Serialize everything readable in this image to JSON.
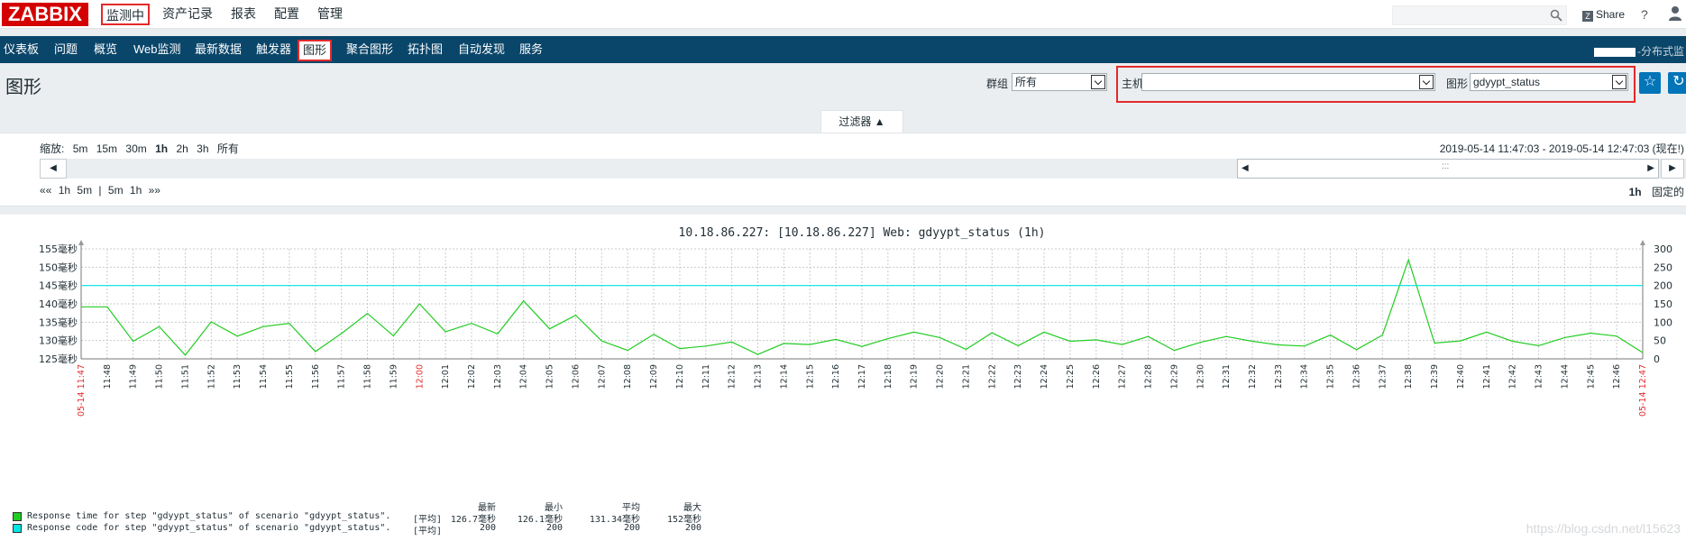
{
  "brand": {
    "logo_text": "ZABBIX",
    "accent": "#d40000",
    "nav_bg": "#0a466a",
    "highlight": "#e4292b"
  },
  "top_menu": [
    {
      "label": "监测中",
      "active": true
    },
    {
      "label": "资产记录",
      "active": false
    },
    {
      "label": "报表",
      "active": false
    },
    {
      "label": "配置",
      "active": false
    },
    {
      "label": "管理",
      "active": false
    }
  ],
  "top_right": {
    "search_value": "",
    "share_label": "Share",
    "help_glyph": "?"
  },
  "sub_menu": [
    {
      "label": "仪表板",
      "active": false
    },
    {
      "label": "问题",
      "active": false
    },
    {
      "label": "概览",
      "active": false
    },
    {
      "label": "Web监测",
      "active": false
    },
    {
      "label": "最新数据",
      "active": false
    },
    {
      "label": "触发器",
      "active": false
    },
    {
      "label": "图形",
      "active": true
    },
    {
      "label": "聚合图形",
      "active": false
    },
    {
      "label": "拓扑图",
      "active": false
    },
    {
      "label": "自动发现",
      "active": false
    },
    {
      "label": "服务",
      "active": false
    }
  ],
  "sub_menu_right": "-分布式监",
  "header": {
    "title": "图形",
    "group_label": "群组",
    "group_value": "所有",
    "host_label": "主机",
    "host_value": "",
    "graph_label": "图形",
    "graph_value": "gdyypt_status",
    "fav_glyph": "☆",
    "refresh_glyph": "↻"
  },
  "filter": {
    "tab_label": "过滤器 ▲",
    "zoom_label": "缩放:",
    "zoom_options": [
      "5m",
      "15m",
      "30m",
      "1h",
      "2h",
      "3h",
      "所有"
    ],
    "zoom_active": "1h",
    "time_range": "2019-05-14 11:47:03 - 2019-05-14 12:47:03 (现在!)",
    "step_left": [
      "««",
      "1h",
      "5m",
      "|",
      "5m",
      "1h",
      "»»"
    ],
    "period_label": "1h",
    "fixed_label": "固定的"
  },
  "chart_data": {
    "type": "line",
    "title": "10.18.86.227: [10.18.86.227] Web: gdyypt_status (1h)",
    "x_labels": [
      "11:48",
      "11:49",
      "11:50",
      "11:51",
      "11:52",
      "11:53",
      "11:54",
      "11:55",
      "11:56",
      "11:57",
      "11:58",
      "11:59",
      "12:00",
      "12:01",
      "12:02",
      "12:03",
      "12:04",
      "12:05",
      "12:06",
      "12:07",
      "12:08",
      "12:09",
      "12:10",
      "12:11",
      "12:12",
      "12:13",
      "12:14",
      "12:15",
      "12:16",
      "12:17",
      "12:18",
      "12:19",
      "12:20",
      "12:21",
      "12:22",
      "12:23",
      "12:24",
      "12:25",
      "12:26",
      "12:27",
      "12:28",
      "12:29",
      "12:30",
      "12:31",
      "12:32",
      "12:33",
      "12:34",
      "12:35",
      "12:36",
      "12:37",
      "12:38",
      "12:39",
      "12:40",
      "12:41",
      "12:42",
      "12:43",
      "12:44",
      "12:45",
      "12:46"
    ],
    "x_start_label": "05-14 11:47",
    "x_end_label": "05-14 12:47",
    "y_left_ticks": [
      "155毫秒",
      "150毫秒",
      "145毫秒",
      "140毫秒",
      "135毫秒",
      "130毫秒",
      "125毫秒"
    ],
    "y_left_range": [
      125,
      155
    ],
    "y_right_ticks": [
      "300",
      "250",
      "200",
      "150",
      "100",
      "50",
      "0"
    ],
    "y_right_range": [
      0,
      300
    ],
    "series": [
      {
        "name": "Response time for step \"gdyypt_status\" of scenario \"gdyypt_status\".",
        "color": "#22cc22",
        "axis": "left",
        "values": [
          139.2,
          139.2,
          129.8,
          133.8,
          126.0,
          135.1,
          131.2,
          133.8,
          134.7,
          127.0,
          131.9,
          137.4,
          131.3,
          140.0,
          132.4,
          134.7,
          131.8,
          140.8,
          133.2,
          136.9,
          129.9,
          127.3,
          131.7,
          127.8,
          128.5,
          129.6,
          126.2,
          129.2,
          128.9,
          130.3,
          128.4,
          130.5,
          132.3,
          130.8,
          127.6,
          132.1,
          128.6,
          132.3,
          129.8,
          130.2,
          128.9,
          131.1,
          127.3,
          129.5,
          131.1,
          129.8,
          128.8,
          128.5,
          131.5,
          127.5,
          131.5,
          152.0,
          129.3,
          129.9,
          132.3,
          129.8,
          128.6,
          130.8,
          132.0,
          131.2,
          126.7
        ],
        "legend_fn": "[平均]",
        "last": "126.7毫秒",
        "min": "126.1毫秒",
        "avg": "131.34毫秒",
        "max": "152毫秒"
      },
      {
        "name": "Response code for step \"gdyypt_status\" of scenario \"gdyypt_status\".",
        "color": "#00e5e5",
        "axis": "right",
        "values": [
          200,
          200,
          200,
          200,
          200,
          200,
          200,
          200,
          200,
          200,
          200,
          200,
          200,
          200,
          200,
          200,
          200,
          200,
          200,
          200,
          200,
          200,
          200,
          200,
          200,
          200,
          200,
          200,
          200,
          200,
          200,
          200,
          200,
          200,
          200,
          200,
          200,
          200,
          200,
          200,
          200,
          200,
          200,
          200,
          200,
          200,
          200,
          200,
          200,
          200,
          200,
          200,
          200,
          200,
          200,
          200,
          200,
          200,
          200,
          200,
          200
        ],
        "legend_fn": "[平均]",
        "last": "200",
        "min": "200",
        "avg": "200",
        "max": "200"
      }
    ],
    "legend_headers": [
      "最新",
      "最小",
      "平均",
      "最大"
    ],
    "grid": true,
    "legend_position": "bottom-left"
  },
  "watermark": "https://blog.csdn.net/l15623"
}
